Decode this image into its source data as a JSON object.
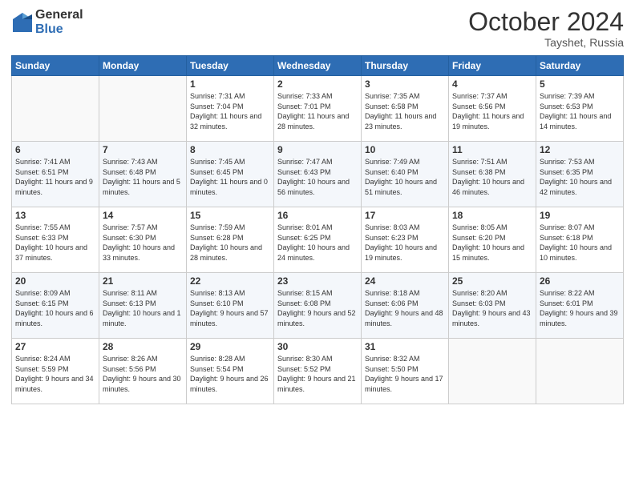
{
  "header": {
    "logo_general": "General",
    "logo_blue": "Blue",
    "month_title": "October 2024",
    "location": "Tayshet, Russia"
  },
  "weekdays": [
    "Sunday",
    "Monday",
    "Tuesday",
    "Wednesday",
    "Thursday",
    "Friday",
    "Saturday"
  ],
  "weeks": [
    [
      {
        "day": "",
        "sunrise": "",
        "sunset": "",
        "daylight": ""
      },
      {
        "day": "",
        "sunrise": "",
        "sunset": "",
        "daylight": ""
      },
      {
        "day": "1",
        "sunrise": "Sunrise: 7:31 AM",
        "sunset": "Sunset: 7:04 PM",
        "daylight": "Daylight: 11 hours and 32 minutes."
      },
      {
        "day": "2",
        "sunrise": "Sunrise: 7:33 AM",
        "sunset": "Sunset: 7:01 PM",
        "daylight": "Daylight: 11 hours and 28 minutes."
      },
      {
        "day": "3",
        "sunrise": "Sunrise: 7:35 AM",
        "sunset": "Sunset: 6:58 PM",
        "daylight": "Daylight: 11 hours and 23 minutes."
      },
      {
        "day": "4",
        "sunrise": "Sunrise: 7:37 AM",
        "sunset": "Sunset: 6:56 PM",
        "daylight": "Daylight: 11 hours and 19 minutes."
      },
      {
        "day": "5",
        "sunrise": "Sunrise: 7:39 AM",
        "sunset": "Sunset: 6:53 PM",
        "daylight": "Daylight: 11 hours and 14 minutes."
      }
    ],
    [
      {
        "day": "6",
        "sunrise": "Sunrise: 7:41 AM",
        "sunset": "Sunset: 6:51 PM",
        "daylight": "Daylight: 11 hours and 9 minutes."
      },
      {
        "day": "7",
        "sunrise": "Sunrise: 7:43 AM",
        "sunset": "Sunset: 6:48 PM",
        "daylight": "Daylight: 11 hours and 5 minutes."
      },
      {
        "day": "8",
        "sunrise": "Sunrise: 7:45 AM",
        "sunset": "Sunset: 6:45 PM",
        "daylight": "Daylight: 11 hours and 0 minutes."
      },
      {
        "day": "9",
        "sunrise": "Sunrise: 7:47 AM",
        "sunset": "Sunset: 6:43 PM",
        "daylight": "Daylight: 10 hours and 56 minutes."
      },
      {
        "day": "10",
        "sunrise": "Sunrise: 7:49 AM",
        "sunset": "Sunset: 6:40 PM",
        "daylight": "Daylight: 10 hours and 51 minutes."
      },
      {
        "day": "11",
        "sunrise": "Sunrise: 7:51 AM",
        "sunset": "Sunset: 6:38 PM",
        "daylight": "Daylight: 10 hours and 46 minutes."
      },
      {
        "day": "12",
        "sunrise": "Sunrise: 7:53 AM",
        "sunset": "Sunset: 6:35 PM",
        "daylight": "Daylight: 10 hours and 42 minutes."
      }
    ],
    [
      {
        "day": "13",
        "sunrise": "Sunrise: 7:55 AM",
        "sunset": "Sunset: 6:33 PM",
        "daylight": "Daylight: 10 hours and 37 minutes."
      },
      {
        "day": "14",
        "sunrise": "Sunrise: 7:57 AM",
        "sunset": "Sunset: 6:30 PM",
        "daylight": "Daylight: 10 hours and 33 minutes."
      },
      {
        "day": "15",
        "sunrise": "Sunrise: 7:59 AM",
        "sunset": "Sunset: 6:28 PM",
        "daylight": "Daylight: 10 hours and 28 minutes."
      },
      {
        "day": "16",
        "sunrise": "Sunrise: 8:01 AM",
        "sunset": "Sunset: 6:25 PM",
        "daylight": "Daylight: 10 hours and 24 minutes."
      },
      {
        "day": "17",
        "sunrise": "Sunrise: 8:03 AM",
        "sunset": "Sunset: 6:23 PM",
        "daylight": "Daylight: 10 hours and 19 minutes."
      },
      {
        "day": "18",
        "sunrise": "Sunrise: 8:05 AM",
        "sunset": "Sunset: 6:20 PM",
        "daylight": "Daylight: 10 hours and 15 minutes."
      },
      {
        "day": "19",
        "sunrise": "Sunrise: 8:07 AM",
        "sunset": "Sunset: 6:18 PM",
        "daylight": "Daylight: 10 hours and 10 minutes."
      }
    ],
    [
      {
        "day": "20",
        "sunrise": "Sunrise: 8:09 AM",
        "sunset": "Sunset: 6:15 PM",
        "daylight": "Daylight: 10 hours and 6 minutes."
      },
      {
        "day": "21",
        "sunrise": "Sunrise: 8:11 AM",
        "sunset": "Sunset: 6:13 PM",
        "daylight": "Daylight: 10 hours and 1 minute."
      },
      {
        "day": "22",
        "sunrise": "Sunrise: 8:13 AM",
        "sunset": "Sunset: 6:10 PM",
        "daylight": "Daylight: 9 hours and 57 minutes."
      },
      {
        "day": "23",
        "sunrise": "Sunrise: 8:15 AM",
        "sunset": "Sunset: 6:08 PM",
        "daylight": "Daylight: 9 hours and 52 minutes."
      },
      {
        "day": "24",
        "sunrise": "Sunrise: 8:18 AM",
        "sunset": "Sunset: 6:06 PM",
        "daylight": "Daylight: 9 hours and 48 minutes."
      },
      {
        "day": "25",
        "sunrise": "Sunrise: 8:20 AM",
        "sunset": "Sunset: 6:03 PM",
        "daylight": "Daylight: 9 hours and 43 minutes."
      },
      {
        "day": "26",
        "sunrise": "Sunrise: 8:22 AM",
        "sunset": "Sunset: 6:01 PM",
        "daylight": "Daylight: 9 hours and 39 minutes."
      }
    ],
    [
      {
        "day": "27",
        "sunrise": "Sunrise: 8:24 AM",
        "sunset": "Sunset: 5:59 PM",
        "daylight": "Daylight: 9 hours and 34 minutes."
      },
      {
        "day": "28",
        "sunrise": "Sunrise: 8:26 AM",
        "sunset": "Sunset: 5:56 PM",
        "daylight": "Daylight: 9 hours and 30 minutes."
      },
      {
        "day": "29",
        "sunrise": "Sunrise: 8:28 AM",
        "sunset": "Sunset: 5:54 PM",
        "daylight": "Daylight: 9 hours and 26 minutes."
      },
      {
        "day": "30",
        "sunrise": "Sunrise: 8:30 AM",
        "sunset": "Sunset: 5:52 PM",
        "daylight": "Daylight: 9 hours and 21 minutes."
      },
      {
        "day": "31",
        "sunrise": "Sunrise: 8:32 AM",
        "sunset": "Sunset: 5:50 PM",
        "daylight": "Daylight: 9 hours and 17 minutes."
      },
      {
        "day": "",
        "sunrise": "",
        "sunset": "",
        "daylight": ""
      },
      {
        "day": "",
        "sunrise": "",
        "sunset": "",
        "daylight": ""
      }
    ]
  ]
}
